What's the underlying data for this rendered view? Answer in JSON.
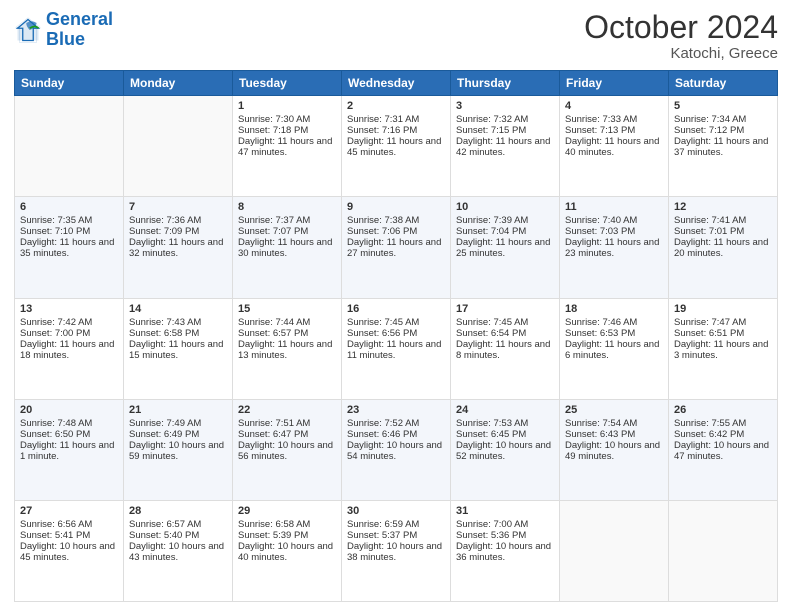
{
  "header": {
    "logo_line1": "General",
    "logo_line2": "Blue",
    "title": "October 2024",
    "subtitle": "Katochi, Greece"
  },
  "days_of_week": [
    "Sunday",
    "Monday",
    "Tuesday",
    "Wednesday",
    "Thursday",
    "Friday",
    "Saturday"
  ],
  "weeks": [
    [
      {
        "num": "",
        "sunrise": "",
        "sunset": "",
        "daylight": ""
      },
      {
        "num": "",
        "sunrise": "",
        "sunset": "",
        "daylight": ""
      },
      {
        "num": "1",
        "sunrise": "Sunrise: 7:30 AM",
        "sunset": "Sunset: 7:18 PM",
        "daylight": "Daylight: 11 hours and 47 minutes."
      },
      {
        "num": "2",
        "sunrise": "Sunrise: 7:31 AM",
        "sunset": "Sunset: 7:16 PM",
        "daylight": "Daylight: 11 hours and 45 minutes."
      },
      {
        "num": "3",
        "sunrise": "Sunrise: 7:32 AM",
        "sunset": "Sunset: 7:15 PM",
        "daylight": "Daylight: 11 hours and 42 minutes."
      },
      {
        "num": "4",
        "sunrise": "Sunrise: 7:33 AM",
        "sunset": "Sunset: 7:13 PM",
        "daylight": "Daylight: 11 hours and 40 minutes."
      },
      {
        "num": "5",
        "sunrise": "Sunrise: 7:34 AM",
        "sunset": "Sunset: 7:12 PM",
        "daylight": "Daylight: 11 hours and 37 minutes."
      }
    ],
    [
      {
        "num": "6",
        "sunrise": "Sunrise: 7:35 AM",
        "sunset": "Sunset: 7:10 PM",
        "daylight": "Daylight: 11 hours and 35 minutes."
      },
      {
        "num": "7",
        "sunrise": "Sunrise: 7:36 AM",
        "sunset": "Sunset: 7:09 PM",
        "daylight": "Daylight: 11 hours and 32 minutes."
      },
      {
        "num": "8",
        "sunrise": "Sunrise: 7:37 AM",
        "sunset": "Sunset: 7:07 PM",
        "daylight": "Daylight: 11 hours and 30 minutes."
      },
      {
        "num": "9",
        "sunrise": "Sunrise: 7:38 AM",
        "sunset": "Sunset: 7:06 PM",
        "daylight": "Daylight: 11 hours and 27 minutes."
      },
      {
        "num": "10",
        "sunrise": "Sunrise: 7:39 AM",
        "sunset": "Sunset: 7:04 PM",
        "daylight": "Daylight: 11 hours and 25 minutes."
      },
      {
        "num": "11",
        "sunrise": "Sunrise: 7:40 AM",
        "sunset": "Sunset: 7:03 PM",
        "daylight": "Daylight: 11 hours and 23 minutes."
      },
      {
        "num": "12",
        "sunrise": "Sunrise: 7:41 AM",
        "sunset": "Sunset: 7:01 PM",
        "daylight": "Daylight: 11 hours and 20 minutes."
      }
    ],
    [
      {
        "num": "13",
        "sunrise": "Sunrise: 7:42 AM",
        "sunset": "Sunset: 7:00 PM",
        "daylight": "Daylight: 11 hours and 18 minutes."
      },
      {
        "num": "14",
        "sunrise": "Sunrise: 7:43 AM",
        "sunset": "Sunset: 6:58 PM",
        "daylight": "Daylight: 11 hours and 15 minutes."
      },
      {
        "num": "15",
        "sunrise": "Sunrise: 7:44 AM",
        "sunset": "Sunset: 6:57 PM",
        "daylight": "Daylight: 11 hours and 13 minutes."
      },
      {
        "num": "16",
        "sunrise": "Sunrise: 7:45 AM",
        "sunset": "Sunset: 6:56 PM",
        "daylight": "Daylight: 11 hours and 11 minutes."
      },
      {
        "num": "17",
        "sunrise": "Sunrise: 7:45 AM",
        "sunset": "Sunset: 6:54 PM",
        "daylight": "Daylight: 11 hours and 8 minutes."
      },
      {
        "num": "18",
        "sunrise": "Sunrise: 7:46 AM",
        "sunset": "Sunset: 6:53 PM",
        "daylight": "Daylight: 11 hours and 6 minutes."
      },
      {
        "num": "19",
        "sunrise": "Sunrise: 7:47 AM",
        "sunset": "Sunset: 6:51 PM",
        "daylight": "Daylight: 11 hours and 3 minutes."
      }
    ],
    [
      {
        "num": "20",
        "sunrise": "Sunrise: 7:48 AM",
        "sunset": "Sunset: 6:50 PM",
        "daylight": "Daylight: 11 hours and 1 minute."
      },
      {
        "num": "21",
        "sunrise": "Sunrise: 7:49 AM",
        "sunset": "Sunset: 6:49 PM",
        "daylight": "Daylight: 10 hours and 59 minutes."
      },
      {
        "num": "22",
        "sunrise": "Sunrise: 7:51 AM",
        "sunset": "Sunset: 6:47 PM",
        "daylight": "Daylight: 10 hours and 56 minutes."
      },
      {
        "num": "23",
        "sunrise": "Sunrise: 7:52 AM",
        "sunset": "Sunset: 6:46 PM",
        "daylight": "Daylight: 10 hours and 54 minutes."
      },
      {
        "num": "24",
        "sunrise": "Sunrise: 7:53 AM",
        "sunset": "Sunset: 6:45 PM",
        "daylight": "Daylight: 10 hours and 52 minutes."
      },
      {
        "num": "25",
        "sunrise": "Sunrise: 7:54 AM",
        "sunset": "Sunset: 6:43 PM",
        "daylight": "Daylight: 10 hours and 49 minutes."
      },
      {
        "num": "26",
        "sunrise": "Sunrise: 7:55 AM",
        "sunset": "Sunset: 6:42 PM",
        "daylight": "Daylight: 10 hours and 47 minutes."
      }
    ],
    [
      {
        "num": "27",
        "sunrise": "Sunrise: 6:56 AM",
        "sunset": "Sunset: 5:41 PM",
        "daylight": "Daylight: 10 hours and 45 minutes."
      },
      {
        "num": "28",
        "sunrise": "Sunrise: 6:57 AM",
        "sunset": "Sunset: 5:40 PM",
        "daylight": "Daylight: 10 hours and 43 minutes."
      },
      {
        "num": "29",
        "sunrise": "Sunrise: 6:58 AM",
        "sunset": "Sunset: 5:39 PM",
        "daylight": "Daylight: 10 hours and 40 minutes."
      },
      {
        "num": "30",
        "sunrise": "Sunrise: 6:59 AM",
        "sunset": "Sunset: 5:37 PM",
        "daylight": "Daylight: 10 hours and 38 minutes."
      },
      {
        "num": "31",
        "sunrise": "Sunrise: 7:00 AM",
        "sunset": "Sunset: 5:36 PM",
        "daylight": "Daylight: 10 hours and 36 minutes."
      },
      {
        "num": "",
        "sunrise": "",
        "sunset": "",
        "daylight": ""
      },
      {
        "num": "",
        "sunrise": "",
        "sunset": "",
        "daylight": ""
      }
    ]
  ]
}
